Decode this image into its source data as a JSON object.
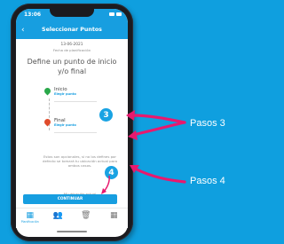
{
  "colors": {
    "background": "#0f9fdf",
    "accent": "#179ee0",
    "annotation_arrow": "#e8196e",
    "start_pin": "#2aa84a",
    "end_pin": "#e04b2b"
  },
  "status_bar": {
    "time": "13:06"
  },
  "header": {
    "back_icon": "chevron-left-icon",
    "title": "Seleccionar Puntos"
  },
  "planning": {
    "date": "13-06-2021",
    "date_label": "Fecha de planificación",
    "prompt": "Define un punto de inicio y/o final"
  },
  "locations": {
    "start": {
      "label": "Inicio",
      "link": "Elegir punto"
    },
    "end": {
      "label": "Final",
      "link": "Elegir punto"
    }
  },
  "note": "Estos son opcionales, si no los defines por defecto se tomará tu ubicación actual para ambos casos.",
  "email_note": "Mi ubicación actual",
  "continue_button": "CONTINUAR",
  "badges": {
    "step3": "3",
    "step4": "4"
  },
  "tabbar": [
    {
      "icon": "calendar-icon",
      "label": "Planificación"
    },
    {
      "icon": "people-icon",
      "label": ""
    },
    {
      "icon": "trash-icon",
      "label": ""
    },
    {
      "icon": "grid-icon",
      "label": ""
    }
  ],
  "annotations": {
    "step3": "Pasos 3",
    "step4": "Pasos 4"
  }
}
